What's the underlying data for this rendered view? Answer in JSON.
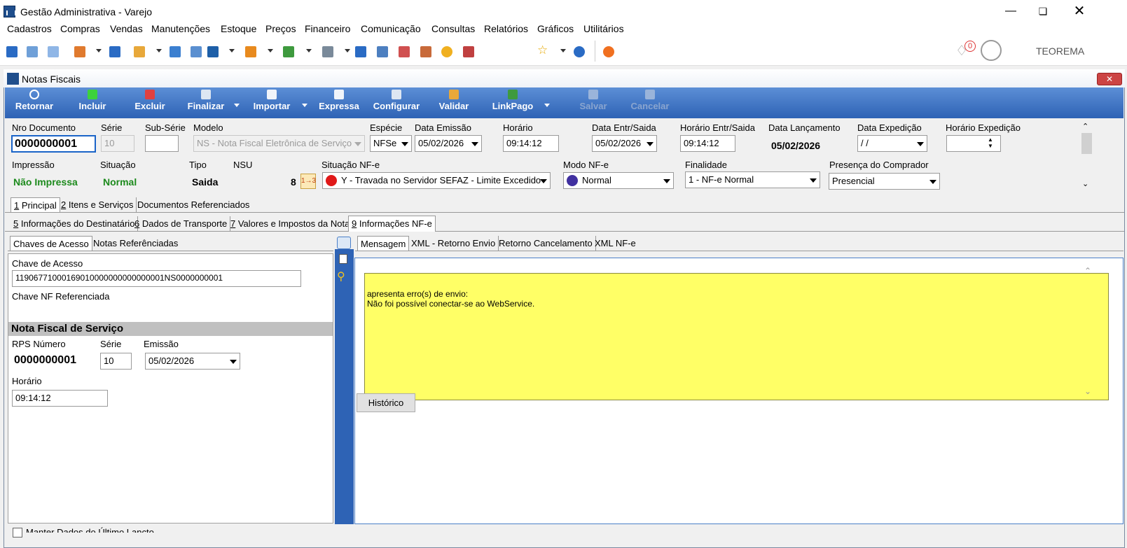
{
  "window": {
    "title": "Gestão Administrativa - Varejo",
    "user": "TEOREMA",
    "notification_count": "0"
  },
  "menu": [
    "Cadastros",
    "Compras",
    "Vendas",
    "Manutenções",
    "Estoque",
    "Preços",
    "Financeiro",
    "Comunicação",
    "Consultas",
    "Relatórios",
    "Gráficos",
    "Utilitários"
  ],
  "child": {
    "title": "Notas Fiscais"
  },
  "ribbon": {
    "retornar": "Retornar",
    "incluir": "Incluir",
    "excluir": "Excluir",
    "finalizar": "Finalizar",
    "importar": "Importar",
    "expressa": "Expressa",
    "configurar": "Configurar",
    "validar": "Validar",
    "linkpago": "LinkPago",
    "salvar": "Salvar",
    "cancelar": "Cancelar"
  },
  "header": {
    "nro_documento_label": "Nro Documento",
    "nro_documento": "0000000001",
    "serie_label": "Série",
    "serie": "10",
    "subserie_label": "Sub-Série",
    "subserie": "",
    "modelo_label": "Modelo",
    "modelo": "NS - Nota Fiscal Eletrônica de Serviço",
    "especie_label": "Espécie",
    "especie": "NFSe",
    "data_emissao_label": "Data Emissão",
    "data_emissao": "05/02/2026",
    "horario_label": "Horário",
    "horario": "09:14:12",
    "data_entr_label": "Data Entr/Saida",
    "data_entr": "05/02/2026",
    "horario_entr_label": "Horário Entr/Saida",
    "horario_entr": "09:14:12",
    "data_lanc_label": "Data Lançamento",
    "data_lanc": "05/02/2026",
    "data_exped_label": "Data Expedição",
    "data_exped": " / /",
    "horario_exped_label": "Horário Expedição",
    "horario_exped": "",
    "impressao_label": "Impressão",
    "impressao": "Não Impressa",
    "situacao_label": "Situação",
    "situacao": "Normal",
    "tipo_label": "Tipo",
    "tipo": "Saida",
    "nsu_label": "NSU",
    "nsu": "8",
    "situacao_nfe_label": "Situação NF-e",
    "situacao_nfe": "Y - Travada no Servidor SEFAZ - Limite Excedido",
    "modo_nfe_label": "Modo NF-e",
    "modo_nfe": "Normal",
    "finalidade_label": "Finalidade",
    "finalidade": "1 - NF-e Normal",
    "presenca_label": "Presença do Comprador",
    "presenca": "Presencial"
  },
  "tabs_row1": [
    {
      "key": "1",
      "label": " Principal"
    },
    {
      "key": "2",
      "label": " Itens e Serviços"
    },
    {
      "key": "",
      "label": "Documentos Referenciados"
    }
  ],
  "tabs_row2": [
    {
      "key": "5",
      "label": " Informações do Destinatário"
    },
    {
      "key": "6",
      "label": " Dados de Transporte"
    },
    {
      "key": "7",
      "label": " Valores e Impostos da Nota"
    },
    {
      "key": "9",
      "label": " Informações NF-e"
    }
  ],
  "left_tabs": [
    "Chaves de Acesso",
    "Notas Referênciadas"
  ],
  "left": {
    "chave_label": "Chave de Acesso",
    "chave": "11906771000169010000000000000001NS0000000001",
    "chave_ref_label": "Chave NF Referenciada",
    "section_title": "Nota Fiscal de Serviço",
    "rps_label": "RPS Número",
    "rps": "0000000001",
    "serie_label": "Série",
    "serie": "10",
    "emissao_label": "Emissão",
    "emissao": "05/02/2026",
    "horario_label": "Horário",
    "horario": "09:14:12",
    "manter_label": "Manter Dados do Último Lançto"
  },
  "right_tabs": [
    "Mensagem",
    "XML - Retorno Envio",
    "Retorno Cancelamento",
    "XML NF-e"
  ],
  "message": {
    "line1": "apresenta erro(s) de envio:",
    "line2": "Não foi possível conectar-se ao WebService."
  },
  "historico_button": "Histórico",
  "colors": {
    "ribbon": "#2e63b5",
    "message_bg": "#ffff66",
    "status_green": "#1c8a1c",
    "sidebar_blue": "#2e63b5"
  }
}
